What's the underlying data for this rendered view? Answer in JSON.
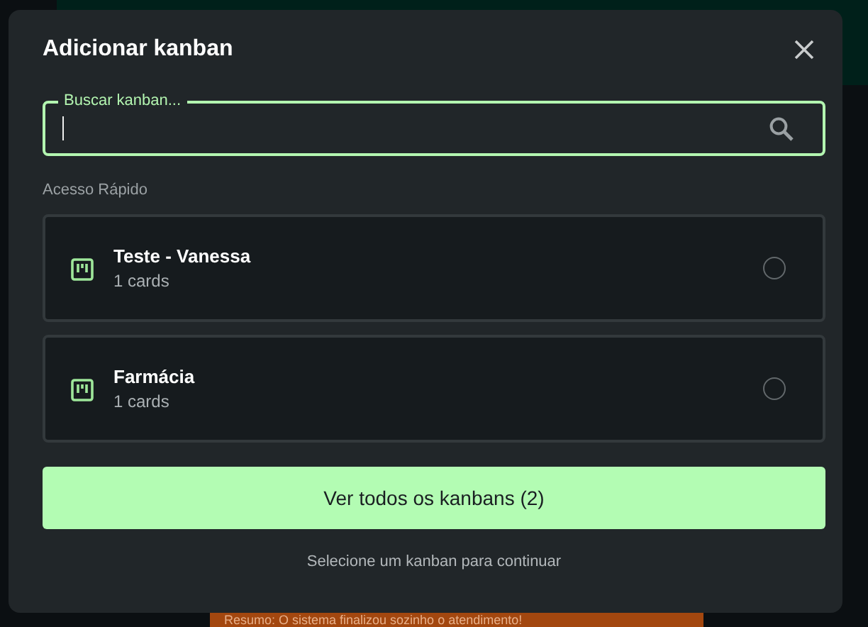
{
  "background": {
    "banner": "Resumo: O sistema finalizou sozinho o atendimento!"
  },
  "dialog": {
    "title": "Adicionar kanban",
    "search": {
      "label": "Buscar kanban...",
      "focused": true
    },
    "section_title": "Acesso Rápido",
    "kanbans": [
      {
        "name": "Teste - Vanessa",
        "count": "1 cards",
        "selected": false
      },
      {
        "name": "Farmácia",
        "count": "1 cards",
        "selected": false
      }
    ],
    "button": "Ver todos os kanbans (2)",
    "hint": "Selecione um kanban para continuar"
  }
}
